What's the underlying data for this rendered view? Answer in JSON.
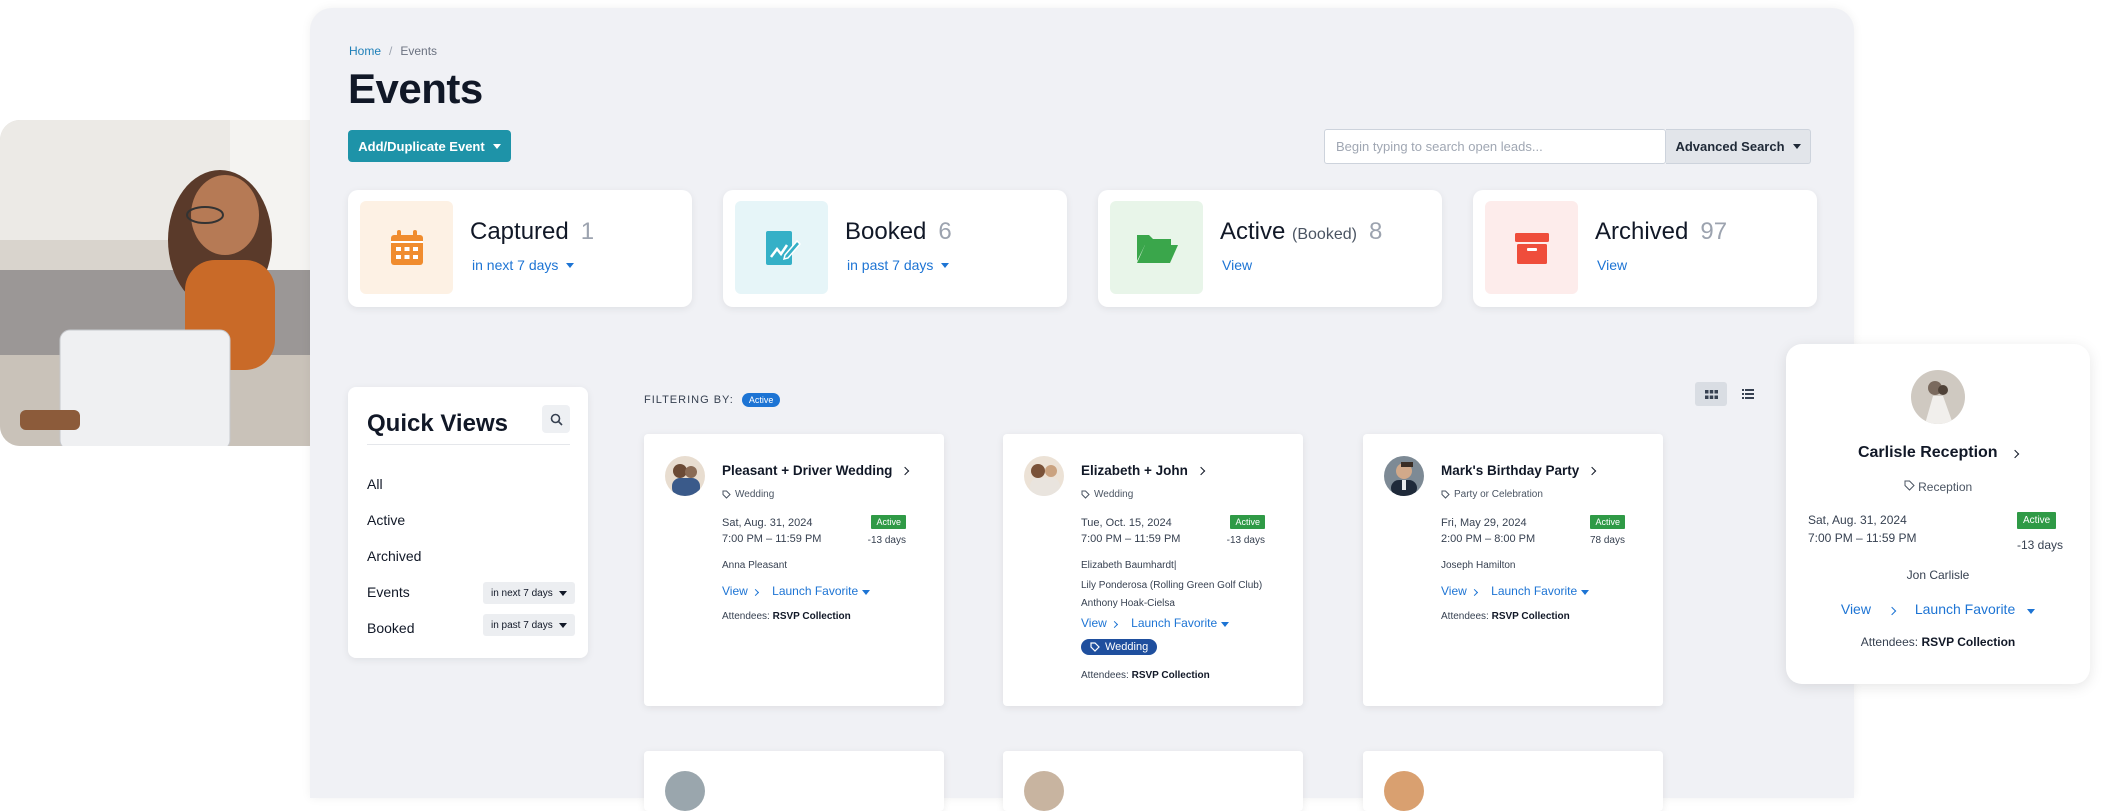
{
  "breadcrumb": {
    "home": "Home",
    "separator": "/",
    "current": "Events"
  },
  "page": {
    "title": "Events"
  },
  "toolbar": {
    "add_label": "Add/Duplicate Event",
    "search_placeholder": "Begin typing to search open leads...",
    "advanced_label": "Advanced Search"
  },
  "stats": [
    {
      "label": "Captured",
      "sub": "",
      "count": "1",
      "link": "in next 7 days",
      "icon": "calendar-icon",
      "color": "#f08c2e",
      "bg": "#fdf1e4"
    },
    {
      "label": "Booked",
      "sub": "",
      "count": "6",
      "link": "in past 7 days",
      "icon": "edit-document-icon",
      "color": "#35b0c7",
      "bg": "#e6f5f8"
    },
    {
      "label": "Active",
      "sub": "(Booked)",
      "count": "8",
      "link": "View",
      "icon": "folder-open-icon",
      "color": "#3aa64b",
      "bg": "#e8f5e9"
    },
    {
      "label": "Archived",
      "sub": "",
      "count": "97",
      "link": "View",
      "icon": "archive-box-icon",
      "color": "#ef4d3b",
      "bg": "#fdeceb"
    }
  ],
  "quick_views": {
    "title": "Quick Views",
    "items": [
      {
        "label": "All"
      },
      {
        "label": "Active"
      },
      {
        "label": "Archived"
      },
      {
        "label": "Events",
        "pill": "in next 7 days"
      },
      {
        "label": "Booked",
        "pill": "in past 7 days"
      }
    ]
  },
  "filter": {
    "label": "FILTERING BY:",
    "chip": "Active"
  },
  "events": [
    {
      "title": "Pleasant + Driver Wedding",
      "type": "Wedding",
      "date": "Sat, Aug. 31, 2024",
      "time": "7:00 PM – 11:59 PM",
      "badge": "Active",
      "days": "-13 days",
      "people": [
        "Anna Pleasant"
      ],
      "view": "View",
      "launch": "Launch Favorite",
      "tag": "",
      "attendees_label": "Attendees:",
      "attendees_value": "RSVP Collection"
    },
    {
      "title": "Elizabeth + John",
      "type": "Wedding",
      "date": "Tue, Oct. 15, 2024",
      "time": "7:00 PM – 11:59 PM",
      "badge": "Active",
      "days": "-13 days",
      "people": [
        "Elizabeth Baumhardt|",
        "Lily Ponderosa (Rolling Green Golf Club)",
        "Anthony Hoak-Cielsa"
      ],
      "view": "View",
      "launch": "Launch Favorite",
      "tag": "Wedding",
      "attendees_label": "Attendees:",
      "attendees_value": "RSVP Collection"
    },
    {
      "title": "Mark's Birthday Party",
      "type": "Party or Celebration",
      "date": "Fri, May 29, 2024",
      "time": "2:00 PM – 8:00 PM",
      "badge": "Active",
      "days": "78 days",
      "people": [
        "Joseph Hamilton"
      ],
      "view": "View",
      "launch": "Launch Favorite",
      "tag": "",
      "attendees_label": "Attendees:",
      "attendees_value": "RSVP Collection"
    }
  ],
  "featured": {
    "title": "Carlisle Reception",
    "type": "Reception",
    "date": "Sat, Aug. 31, 2024",
    "time": "7:00 PM – 11:59 PM",
    "badge": "Active",
    "days": "-13 days",
    "person": "Jon Carlisle",
    "view": "View",
    "launch": "Launch Favorite",
    "attendees_label": "Attendees:",
    "attendees_value": "RSVP Collection"
  },
  "colors": {
    "accent": "#1e93a8",
    "link": "#1d74d4",
    "active_badge": "#2f9a46",
    "tag": "#1f4f9e"
  }
}
